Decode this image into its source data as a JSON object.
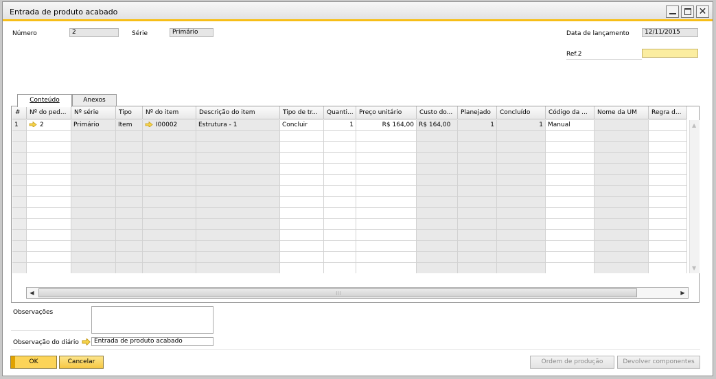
{
  "window": {
    "title": "Entrada de produto acabado"
  },
  "header": {
    "numero_label": "Número",
    "numero_value": "2",
    "serie_label": "Série",
    "serie_value": "Primário",
    "data_label": "Data de lançamento",
    "data_value": "12/11/2015",
    "ref2_label": "Ref.2",
    "ref2_value": ""
  },
  "tabs": [
    {
      "label": "Conteúdo",
      "active": true
    },
    {
      "label": "Anexos",
      "active": false
    }
  ],
  "table": {
    "columns": [
      "#",
      "Nº do ped...",
      "Nº série",
      "Tipo",
      "Nº do item",
      "Descrição do item",
      "Tipo de tr...",
      "Quanti...",
      "Preço unitário",
      "Custo do...",
      "Planejado",
      "Concluído",
      "Código da ...",
      "Nome da UM",
      "Regra d..."
    ],
    "row": {
      "num": "1",
      "pedido": "2",
      "serie": "Primário",
      "tipo": "Item",
      "item": "I00002",
      "descricao": "Estrutura - 1",
      "tipo_tr": "Concluir",
      "quantidade": "1",
      "preco": "R$ 164,00",
      "custo": "R$ 164,00",
      "planejado": "1",
      "concluido": "1",
      "codigo": "Manual"
    }
  },
  "footer": {
    "observacoes_label": "Observações",
    "observacoes_value": "",
    "obs_diario_label": "Observação do diário",
    "obs_diario_value": "Entrada de produto acabado",
    "ok_label": "OK",
    "cancel_label": "Cancelar",
    "ordem_label": "Ordem de produção",
    "devolver_label": "Devolver componentes"
  },
  "colors": {
    "accent": "#f7be17",
    "button": "#fcd458",
    "field_active": "#fbeda0"
  },
  "icons": [
    "link-arrow-icon",
    "minimize-icon",
    "maximize-icon",
    "close-icon"
  ]
}
